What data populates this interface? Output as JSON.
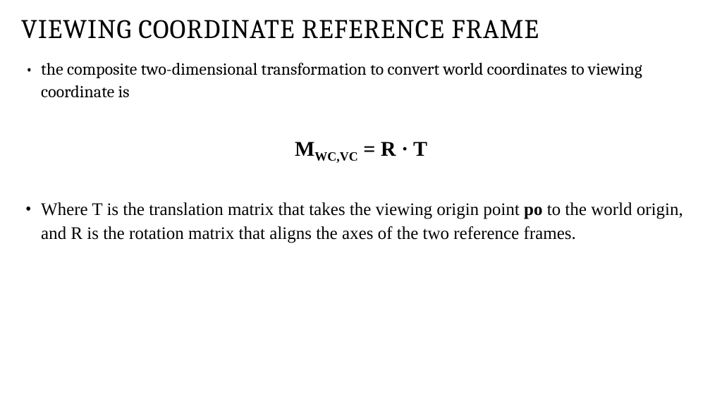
{
  "title": "VIEWING COORDINATE REFERENCE FRAME",
  "bullets": {
    "b1": "the composite two-dimensional transformation to convert world coordinates to viewing coordinate is",
    "b2_part1": "Where T is the translation matrix that takes the viewing origin point ",
    "b2_bold": "po",
    "b2_part2": " to the world origin, and R is the rotation matrix that aligns the axes of the two reference frames."
  },
  "equation": {
    "M": "M",
    "sub": "WC,VC",
    "eq": " = ",
    "R": "R",
    "dot": " · ",
    "T": "T"
  }
}
